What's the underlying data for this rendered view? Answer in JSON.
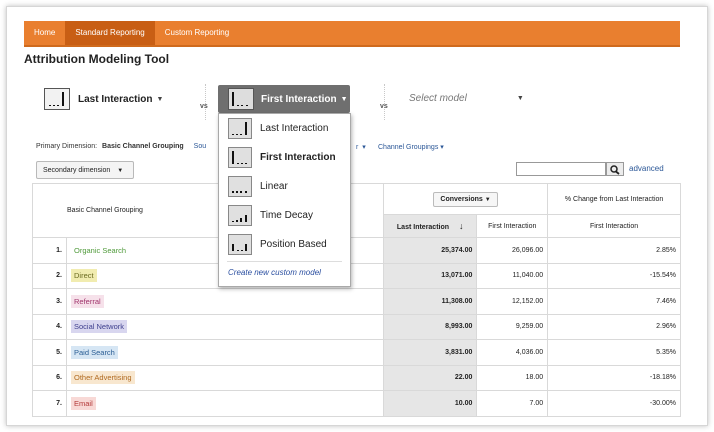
{
  "nav": {
    "tabs": [
      {
        "label": "Home"
      },
      {
        "label": "Standard Reporting"
      },
      {
        "label": "Custom Reporting"
      }
    ]
  },
  "page": {
    "title": "Attribution Modeling Tool"
  },
  "models": {
    "first_selector": "Last Interaction",
    "vs_label": "vs",
    "second_selector": "First Interaction",
    "third_placeholder": "Select model",
    "dropdown_items": [
      {
        "label": "Last Interaction"
      },
      {
        "label": "First Interaction"
      },
      {
        "label": "Linear"
      },
      {
        "label": "Time Decay"
      },
      {
        "label": "Position Based"
      }
    ],
    "create_link": "Create new custom model"
  },
  "toolbar": {
    "primary_label": "Primary Dimension:",
    "primary_value": "Basic Channel Grouping",
    "source_partial": "Sou",
    "other_partial": "r",
    "channel_groupings": "Channel Groupings",
    "secondary_dimension": "Secondary dimension",
    "advanced": "advanced"
  },
  "table": {
    "dimension_header": "Basic Channel Grouping",
    "conversions_btn": "Conversions",
    "change_header": "% Change from Last Interaction",
    "sub_headers": [
      "Last Interaction",
      "First Interaction",
      "First Interaction"
    ],
    "rows": [
      {
        "idx": "1.",
        "channel": "Organic Search",
        "color": "#4f9a3a",
        "bg": "transparent",
        "last": "25,374.00",
        "first": "26,096.00",
        "change": "2.85%"
      },
      {
        "idx": "2.",
        "channel": "Direct",
        "color": "#6a6a20",
        "bg": "#f1ecb0",
        "last": "13,071.00",
        "first": "11,040.00",
        "change": "-15.54%"
      },
      {
        "idx": "3.",
        "channel": "Referral",
        "color": "#a0336b",
        "bg": "#f6e1ea",
        "last": "11,308.00",
        "first": "12,152.00",
        "change": "7.46%"
      },
      {
        "idx": "4.",
        "channel": "Social Network",
        "color": "#3e3f8e",
        "bg": "#d8d6ef",
        "last": "8,993.00",
        "first": "9,259.00",
        "change": "2.96%"
      },
      {
        "idx": "5.",
        "channel": "Paid Search",
        "color": "#2b5e94",
        "bg": "#d6e6f4",
        "last": "3,831.00",
        "first": "4,036.00",
        "change": "5.35%"
      },
      {
        "idx": "6.",
        "channel": "Other Advertising",
        "color": "#b06a20",
        "bg": "#f8e7cf",
        "last": "22.00",
        "first": "18.00",
        "change": "-18.18%"
      },
      {
        "idx": "7.",
        "channel": "Email",
        "color": "#b43a3a",
        "bg": "#f8d9d6",
        "last": "10.00",
        "first": "7.00",
        "change": "-30.00%"
      }
    ]
  }
}
